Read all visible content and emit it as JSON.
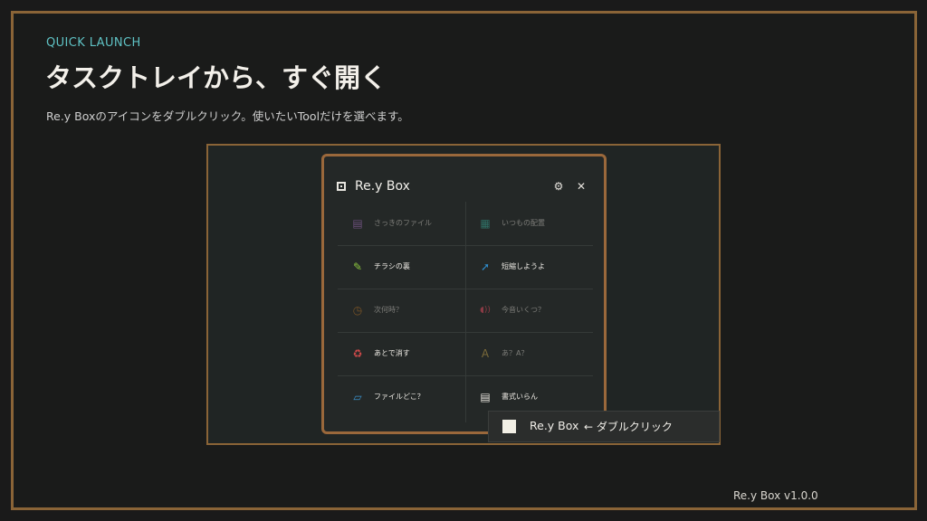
{
  "slide": {
    "eyebrow": "QUICK LAUNCH",
    "title": "タスクトレイから、すぐ開く",
    "subtitle": "Re.y Boxのアイコンをダブルクリック。使いたいToolだけを選べます。",
    "version": "Re.y Box  v1.0.0",
    "accent_color": "#5fc2c4",
    "frame_color": "#8a6437"
  },
  "window": {
    "title": "Re.y Box",
    "settings_icon": "gear-icon",
    "close_icon": "close-icon",
    "settings_glyph": "⚙",
    "close_glyph": "✕"
  },
  "tools": [
    {
      "label": "さっきのファイル",
      "icon": "file-list-icon",
      "glyph": "▤",
      "color": "#6b4f7a",
      "state": "dim"
    },
    {
      "label": "いつもの配置",
      "icon": "grid-layout-icon",
      "glyph": "▦",
      "color": "#2f6f65",
      "state": "dim"
    },
    {
      "label": "チラシの裏",
      "icon": "pencil-icon",
      "glyph": "✎",
      "color": "#8cc63f",
      "state": "active"
    },
    {
      "label": "短縮しようよ",
      "icon": "arrow-link-icon",
      "glyph": "➚",
      "color": "#2f8fd0",
      "state": "active"
    },
    {
      "label": "次何時？",
      "icon": "clock-icon",
      "glyph": "◷",
      "color": "#7a5426",
      "state": "dim"
    },
    {
      "label": "今音いくつ？",
      "icon": "volume-icon",
      "glyph": "◖))",
      "color": "#8a3b45",
      "state": "dim"
    },
    {
      "label": "あとで消す",
      "icon": "recycle-icon",
      "glyph": "♻",
      "color": "#d04a4a",
      "state": "active"
    },
    {
      "label": "あ？A？",
      "icon": "font-a-icon",
      "glyph": "A",
      "color": "#7a6a3a",
      "state": "dim"
    },
    {
      "label": "ファイルどこ？",
      "icon": "folder-icon",
      "glyph": "▱",
      "color": "#3a8fc9",
      "state": "active"
    },
    {
      "label": "書式いらん",
      "icon": "text-format-icon",
      "glyph": "▤",
      "color": "#e6e3dc",
      "state": "active"
    }
  ],
  "tray_tooltip": {
    "name": "Re.y Box",
    "hint": "← ダブルクリック"
  }
}
